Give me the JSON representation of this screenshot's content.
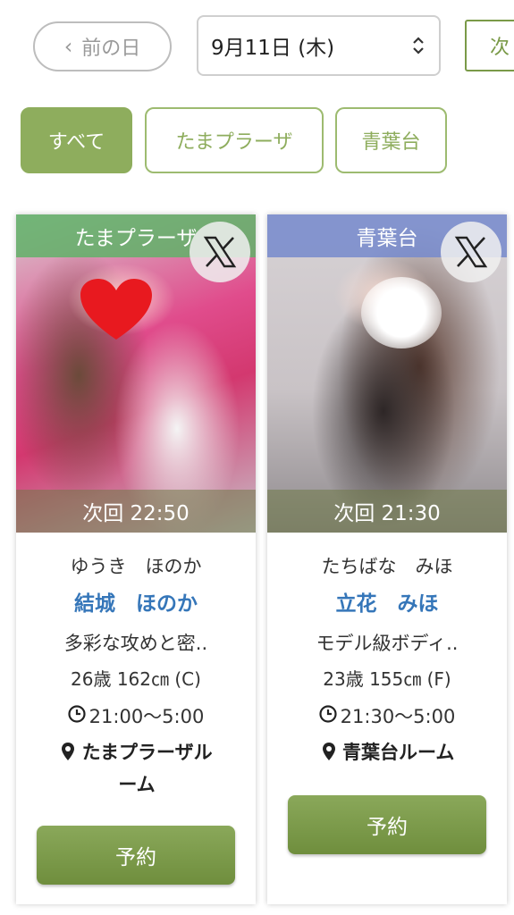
{
  "nav": {
    "prev_label": "前の日",
    "date_value": "9月11日 (木)",
    "next_label": "次"
  },
  "filters": [
    {
      "label": "すべて",
      "active": true
    },
    {
      "label": "たまプラーザ",
      "active": false
    },
    {
      "label": "青葉台",
      "active": false
    }
  ],
  "cards": [
    {
      "area": "たまプラーザ",
      "next": "次回 22:50",
      "kana": "ゆうき　ほのか",
      "name": "結城　ほのか",
      "catch": "多彩な攻めと密..",
      "spec": "26歳 162㎝ (C)",
      "time": "21:00〜5:00",
      "room": "たまプラーザル\nーム",
      "room_line1": "たまプラーザル",
      "room_line2": "ーム",
      "reserve": "予約"
    },
    {
      "area": "青葉台",
      "next": "次回 21:30",
      "kana": "たちばな　みほ",
      "name": "立花　みほ",
      "catch": "モデル級ボディ..",
      "spec": "23歳 155㎝ (F)",
      "time": "21:30〜5:00",
      "room": "青葉台ルーム",
      "reserve": "予約"
    }
  ],
  "colors": {
    "accent": "#8ead5d",
    "name_blue": "#3576b9",
    "band_green": "#60b268",
    "band_blue": "#758acc"
  },
  "icons": [
    "chevron-left-icon",
    "updown-arrow-icon",
    "x-logo-icon",
    "clock-icon",
    "location-pin-icon"
  ]
}
